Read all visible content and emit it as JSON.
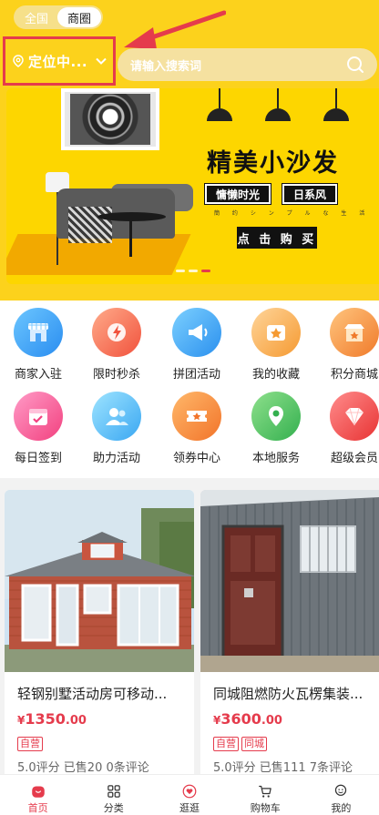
{
  "header": {
    "scope_tabs": [
      "全国",
      "商圈"
    ],
    "active_scope": "商圈",
    "location_label": "定位中...",
    "search_placeholder": "请输入搜索词",
    "annotation_color": "#e53b4c"
  },
  "banner": {
    "headline": "精美小沙发",
    "tags": [
      "慵懒时光",
      "日系风"
    ],
    "tagline": "簡 约 シ ン プ ル な 生 活",
    "cta": "点 击 购 买",
    "slide_count": 3,
    "active_slide": 3
  },
  "grid": {
    "items": [
      {
        "label": "商家入驻",
        "icon": "storefront-icon"
      },
      {
        "label": "限时秒杀",
        "icon": "lightning-clock-icon"
      },
      {
        "label": "拼团活动",
        "icon": "megaphone-icon"
      },
      {
        "label": "我的收藏",
        "icon": "star-box-icon"
      },
      {
        "label": "积分商城",
        "icon": "shop-icon"
      },
      {
        "label": "每日签到",
        "icon": "calendar-check-icon"
      },
      {
        "label": "助力活动",
        "icon": "people-icon"
      },
      {
        "label": "领券中心",
        "icon": "coupon-icon"
      },
      {
        "label": "本地服务",
        "icon": "map-pin-icon"
      },
      {
        "label": "超级会员",
        "icon": "diamond-icon"
      }
    ]
  },
  "products": [
    {
      "title": "轻钢别墅活动房可移动...",
      "currency": "¥",
      "price_int": "1350",
      "price_dec": ".00",
      "badges": [
        "自营"
      ],
      "stats": "5.0评分  已售20  0条评论"
    },
    {
      "title": "同城阻燃防火瓦楞集装...",
      "currency": "¥",
      "price_int": "3600",
      "price_dec": ".00",
      "badges": [
        "自营",
        "同城"
      ],
      "stats": "5.0评分  已售111  7条评论"
    }
  ],
  "bottom_nav": {
    "items": [
      {
        "label": "首页",
        "icon": "home-icon",
        "active": true
      },
      {
        "label": "分类",
        "icon": "grid-icon"
      },
      {
        "label": "逛逛",
        "icon": "heart-chat-icon"
      },
      {
        "label": "购物车",
        "icon": "cart-icon"
      },
      {
        "label": "我的",
        "icon": "user-icon"
      }
    ]
  },
  "colors": {
    "brand_yellow": "#fcd21c",
    "accent_red": "#e53b4c"
  }
}
